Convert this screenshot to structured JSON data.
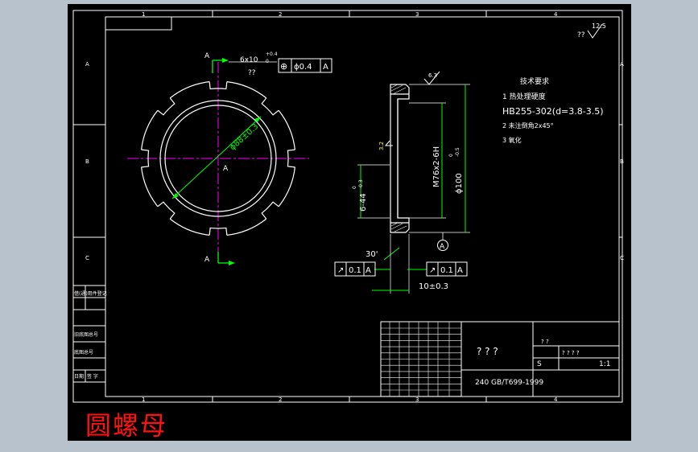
{
  "caption": "圆螺母",
  "colors": {
    "background": "#000000",
    "frame": "#ffffff",
    "dimension": "#00ff00",
    "centerline": "#ff00ff",
    "caption": "#ff1010",
    "outer_bg": "#b8c2cc"
  },
  "border": {
    "top_zones": [
      "1",
      "2",
      "3",
      "4"
    ],
    "bottom_zones": [
      "1",
      "2",
      "3",
      "4"
    ],
    "left_rows": [
      "A",
      "B",
      "C"
    ],
    "right_rows": [
      "A",
      "B",
      "C"
    ]
  },
  "roughness": {
    "corner_symbol": "??",
    "corner_value": "12.5",
    "face": "6.3",
    "thread": "3.2"
  },
  "view": {
    "section_label": "A",
    "section_label_bottom": "A",
    "center_label": "A",
    "slot": "6x10",
    "slot_tol_upper": "+0.4",
    "slot_tol_lower": "0",
    "slot_note": "??",
    "position_tolerance": {
      "symbol": "⊕",
      "value": "ϕ0.4",
      "datum": "A"
    },
    "diameter": "ϕ88±0.3"
  },
  "section": {
    "thread": "M76x2-6H",
    "outer_dia": "ϕ100",
    "outer_tol_upper": "0",
    "outer_tol_lower": "-0.5",
    "slot_depth": "6-44",
    "slot_depth_tol_upper": "0",
    "slot_depth_tol_lower": "-0.3",
    "chamfer_angle": "30'",
    "width": "10±0.3",
    "datum": "A",
    "runout_left": {
      "symbol": "↗",
      "value": "0.1",
      "datum": "A"
    },
    "runout_right": {
      "symbol": "↗",
      "value": "0.1",
      "datum": "A"
    }
  },
  "tech_requirements": {
    "title": "技术要求",
    "items": [
      "1  热处理硬度",
      "HB255-302(d=3.8-3.5)",
      "2  未注倒角2x45°",
      "3  氧化"
    ]
  },
  "title_block": {
    "name_placeholder": "? ? ?",
    "standard": "240 GB/T699-1999",
    "scale": "1:1",
    "qmarks": "?  ?",
    "qrow": "?   ?   ?   ?",
    "s_label": "S"
  },
  "left_table": [
    "借(通)用件登记",
    "旧底图总号",
    "底图总号",
    "签  字",
    "日期"
  ]
}
